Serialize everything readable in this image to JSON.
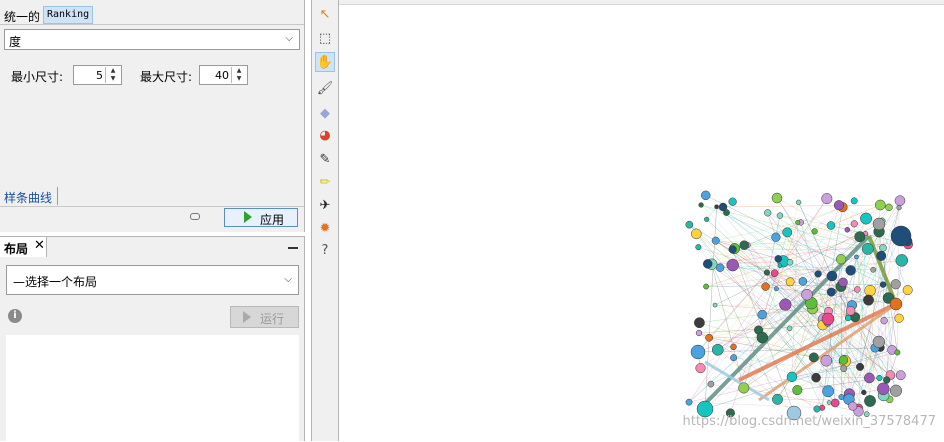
{
  "ranking": {
    "label_prefix": "统一的",
    "tab_ranking": "Ranking",
    "attribute_selected": "度",
    "min_size_label": "最小尺寸:",
    "min_size_value": "5",
    "max_size_label": "最大尺寸:",
    "max_size_value": "40",
    "spline_link": "样条曲线",
    "apply_label": "应用"
  },
  "layout": {
    "tab_label": "布局",
    "close_glyph": "✕",
    "select_placeholder": "—选择一个布局",
    "run_label": "运行",
    "info_glyph": "i"
  },
  "toolbar": {
    "tools": [
      {
        "icon": "pointer-arrow-icon",
        "glyph": "↖",
        "color": "#d98a16"
      },
      {
        "icon": "rectangle-select-icon",
        "glyph": "⬚",
        "color": "#333333"
      },
      {
        "icon": "drag-hand-icon",
        "glyph": "✋",
        "color": "#c9902b",
        "active": true
      },
      {
        "icon": "brush-icon",
        "glyph": "🖌",
        "color": "#555555"
      },
      {
        "icon": "diamond-icon",
        "glyph": "◆",
        "color": "#9aa6d6"
      },
      {
        "icon": "color-palette-icon",
        "glyph": "◕",
        "color": "#d9432a"
      },
      {
        "icon": "pencil-icon",
        "glyph": "✎",
        "color": "#333333"
      },
      {
        "icon": "highlighter-icon",
        "glyph": "✏",
        "color": "#d6c21a"
      },
      {
        "icon": "airplane-icon",
        "glyph": "✈",
        "color": "#222222"
      },
      {
        "icon": "gear-icon",
        "glyph": "✹",
        "color": "#e2711d"
      },
      {
        "icon": "help-pointer-icon",
        "glyph": "?",
        "color": "#555555"
      }
    ]
  },
  "canvas": {
    "watermark": "https://blog.csdn.net/weixin_37578477"
  }
}
